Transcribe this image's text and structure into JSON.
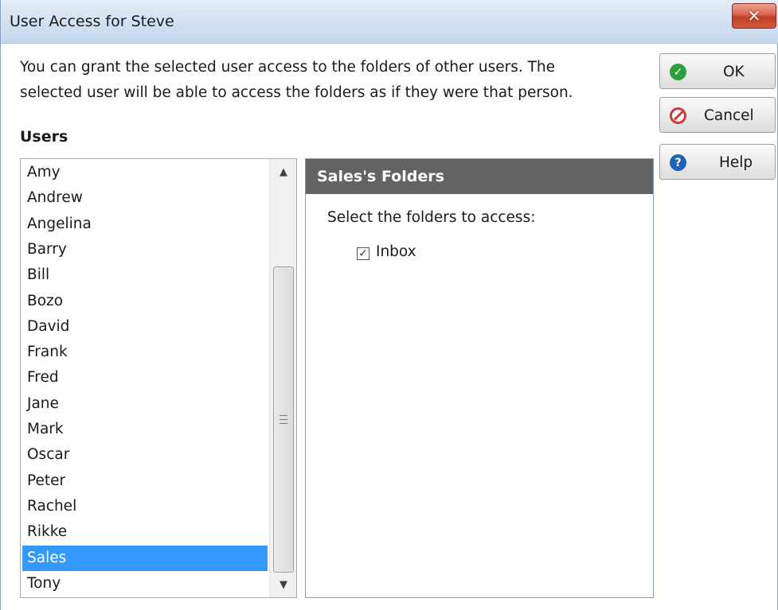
{
  "window": {
    "title": "User Access for Steve",
    "close_glyph": "✕"
  },
  "intro": {
    "line1": "You can grant the selected user access to the folders of other users.  The",
    "line2": "selected user will be able to access the folders as if they were that person."
  },
  "users": {
    "heading": "Users",
    "items": [
      "Amy",
      "Andrew",
      "Angelina",
      "Barry",
      "Bill",
      "Bozo",
      "David",
      "Frank",
      "Fred",
      "Jane",
      "Mark",
      "Oscar",
      "Peter",
      "Rachel",
      "Rikke",
      "Sales",
      "Tony"
    ],
    "selected": "Sales"
  },
  "folders": {
    "header": "Sales's Folders",
    "prompt": "Select the folders to access:",
    "items": [
      {
        "label": "Inbox",
        "checked": true
      }
    ]
  },
  "buttons": {
    "ok": "OK",
    "cancel": "Cancel",
    "help": "Help"
  },
  "icons": {
    "ok": "check-circle-icon",
    "cancel": "no-entry-icon",
    "help": "question-circle-icon"
  },
  "colors": {
    "selection": "#3399ff",
    "panel_header": "#636363",
    "ok_icon": "#2e9f3e",
    "cancel_icon": "#d4362b",
    "help_icon": "#1e63b5"
  }
}
